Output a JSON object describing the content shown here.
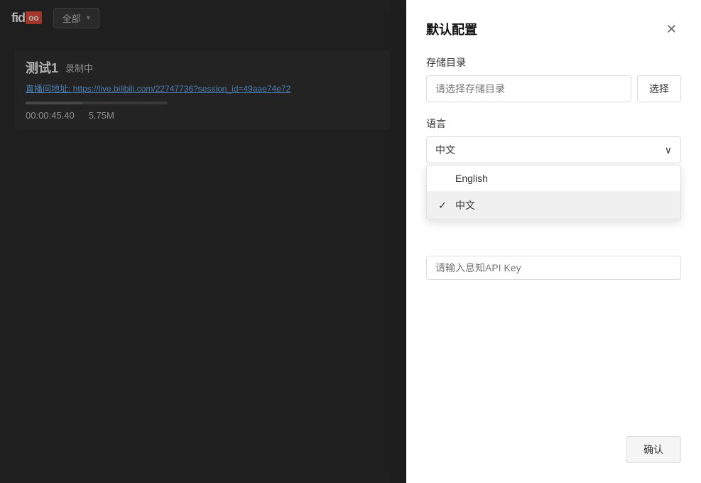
{
  "app": {
    "logo_text": "fid",
    "logo_box": "oo",
    "dropdown_label": "全部",
    "dropdown_arrow": "▾"
  },
  "recording": {
    "name": "测试1",
    "status": "录制中",
    "url_label": "直播间地址:",
    "url": "https://live.bilibili.com/22747736?session_id=49aae74e72",
    "time": "00:00:45.40",
    "size": "5.75M"
  },
  "modal": {
    "title": "默认配置",
    "close_label": "✕",
    "storage_label": "存储目录",
    "storage_placeholder": "请选择存储目录",
    "select_button_label": "选择",
    "language_label": "语言",
    "current_language": "中文",
    "language_arrow": "∨",
    "language_options": [
      {
        "value": "english",
        "label": "English",
        "selected": false
      },
      {
        "value": "chinese",
        "label": "中文",
        "selected": true
      }
    ],
    "api_key_placeholder": "请输入息知API Key",
    "confirm_button_label": "确认"
  }
}
